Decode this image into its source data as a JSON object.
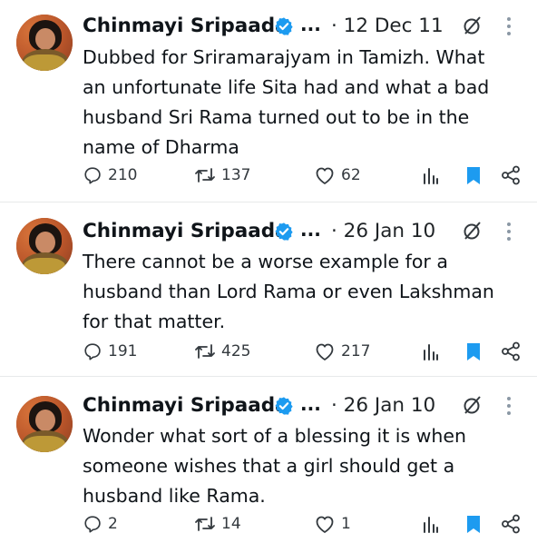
{
  "colors": {
    "text": "#0f1419",
    "verified_blue": "#1d9bf0",
    "bookmark_blue": "#1d9bf0",
    "icon_gray": "#33393e",
    "divider": "#e7e9ea"
  },
  "icons": {
    "verified": "verified-badge-icon",
    "no_edit": "no-edit-icon",
    "more": "more-vertical-icon",
    "reply": "reply-icon",
    "retweet": "retweet-icon",
    "like": "heart-icon",
    "views": "views-bar-chart-icon",
    "bookmark": "bookmark-icon",
    "share": "share-icon"
  },
  "tweets": [
    {
      "author": "Chinmayi Sripaada",
      "ellipsis": "...",
      "date": "· 12 Dec 11",
      "text": "Dubbed for Sriramarajyam in Tamizh. What an unfortunate life Sita had and what a bad husband Sri Rama turned out to be in the name of Dharma",
      "replies": "210",
      "retweets": "137",
      "likes": "62"
    },
    {
      "author": "Chinmayi Sripaada",
      "ellipsis": "...",
      "date": "· 26 Jan 10",
      "text": "There cannot be a worse example for a husband than Lord Rama or even Lakshman for that matter.",
      "replies": "191",
      "retweets": "425",
      "likes": "217"
    },
    {
      "author": "Chinmayi Sripaada",
      "ellipsis": "...",
      "date": "· 26 Jan 10",
      "text": "Wonder what sort of a blessing it is when someone wishes that a girl should get a husband like Rama.",
      "replies": "2",
      "retweets": "14",
      "likes": "1"
    }
  ]
}
